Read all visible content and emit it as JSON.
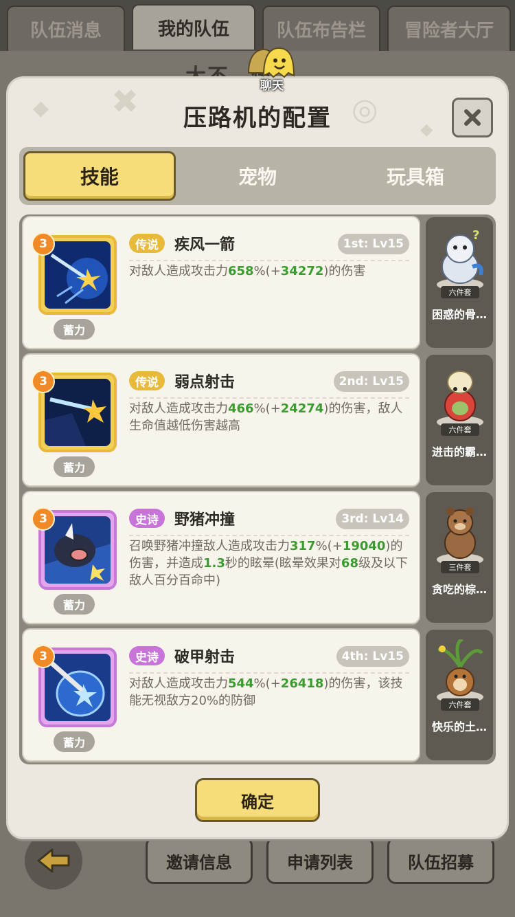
{
  "top_tabs": [
    "队伍消息",
    "我的队伍",
    "队伍布告栏",
    "冒险者大厅"
  ],
  "background": {
    "title": "大不…伍"
  },
  "chat": {
    "label": "聊天"
  },
  "modal": {
    "title": "压路机的配置",
    "close_icon": "×"
  },
  "tabs": [
    "技能",
    "宠物",
    "玩具箱"
  ],
  "skills": [
    {
      "star": "3",
      "rarity": "传说",
      "name": "疾风一箭",
      "slot": "1st: Lv15",
      "charge": "蓄力",
      "desc_parts": [
        "对敌人造成攻击力",
        "658",
        "%(+",
        "34272",
        ")的伤害"
      ]
    },
    {
      "star": "3",
      "rarity": "传说",
      "name": "弱点射击",
      "slot": "2nd: Lv15",
      "charge": "蓄力",
      "desc_parts": [
        "对敌人造成攻击力",
        "466",
        "%(+",
        "24274",
        ")的伤害，敌人生命值越低伤害越高"
      ]
    },
    {
      "star": "3",
      "rarity": "史诗",
      "name": "野猪冲撞",
      "slot": "3rd: Lv14",
      "charge": "蓄力",
      "desc_parts": [
        "召唤野猪冲撞敌人造成攻击力",
        "317",
        "%(+",
        "19040",
        ")的伤害，并造成",
        "1.3",
        "秒的眩晕(眩晕效果对",
        "68",
        "级及以下敌人百分百命中)"
      ]
    },
    {
      "star": "3",
      "rarity": "史诗",
      "name": "破甲射击",
      "slot": "4th: Lv15",
      "charge": "蓄力",
      "desc_parts": [
        "对敌人造成攻击力",
        "544",
        "%(+",
        "26418",
        ")的伤害，该技能无视敌方20%的防御"
      ]
    }
  ],
  "pets": [
    {
      "name": "困惑的骨…",
      "set": "六件套",
      "color": "#cfd8e6"
    },
    {
      "name": "进击的霸…",
      "set": "六件套",
      "color": "#d9453b"
    },
    {
      "name": "贪吃的棕…",
      "set": "三件套",
      "color": "#9a6a43"
    },
    {
      "name": "快乐的土…",
      "set": "六件套",
      "color": "#b3743a"
    }
  ],
  "confirm": "确定",
  "bottom_buttons": [
    "邀请信息",
    "申请列表",
    "队伍招募"
  ],
  "colors": {
    "accent_yellow": "#f6dd79",
    "legend": "#e9b93a",
    "epic": "#c873d8",
    "value_green": "#3a9b2e"
  }
}
